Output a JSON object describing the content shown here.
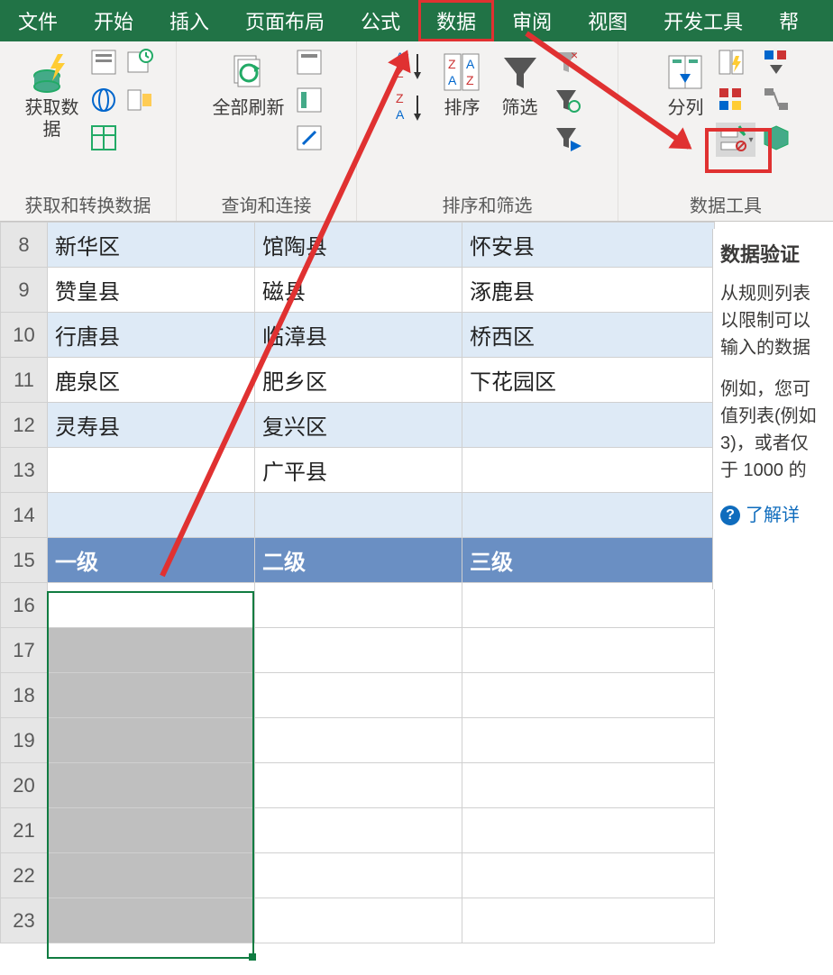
{
  "ribbon": {
    "tabs": [
      "文件",
      "开始",
      "插入",
      "页面布局",
      "公式",
      "数据",
      "审阅",
      "视图",
      "开发工具",
      "帮"
    ],
    "active_index": 5,
    "groups": [
      {
        "id": "get-transform",
        "label": "获取和转换数据",
        "big": {
          "label": "获取数\n据"
        }
      },
      {
        "id": "queries",
        "label": "查询和连接",
        "big": {
          "label": "全部刷新"
        }
      },
      {
        "id": "sort-filter",
        "label": "排序和筛选",
        "big1": {
          "label": "排序"
        },
        "big2": {
          "label": "筛选"
        }
      },
      {
        "id": "data-tools",
        "label": "数据工具",
        "big": {
          "label": "分列"
        }
      }
    ]
  },
  "tooltip": {
    "title": "数据验证",
    "body1": "从规则列表",
    "body2": "以限制可以",
    "body3": "输入的数据",
    "body4": "例如，您可",
    "body5": "值列表(例如",
    "body6": "3)，或者仅",
    "body7": "于 1000 的",
    "link": "了解详"
  },
  "sheet": {
    "rows": [
      {
        "n": 8,
        "cls": "alt-blue",
        "a": "新华区",
        "b": "馆陶县",
        "c": "怀安县"
      },
      {
        "n": 9,
        "cls": "",
        "a": "赞皇县",
        "b": "磁县",
        "c": "涿鹿县"
      },
      {
        "n": 10,
        "cls": "alt-blue",
        "a": "行唐县",
        "b": "临漳县",
        "c": "桥西区"
      },
      {
        "n": 11,
        "cls": "",
        "a": "鹿泉区",
        "b": "肥乡区",
        "c": "下花园区"
      },
      {
        "n": 12,
        "cls": "alt-blue",
        "a": "灵寿县",
        "b": "复兴区",
        "c": ""
      },
      {
        "n": 13,
        "cls": "",
        "a": "",
        "b": "广平县",
        "c": ""
      },
      {
        "n": 14,
        "cls": "alt-blue",
        "a": "",
        "b": "",
        "c": ""
      }
    ],
    "header_row": {
      "n": 15,
      "a": "一级",
      "b": "二级",
      "c": "三级"
    },
    "empty_rows": [
      16,
      17,
      18,
      19,
      20,
      21,
      22,
      23
    ]
  }
}
